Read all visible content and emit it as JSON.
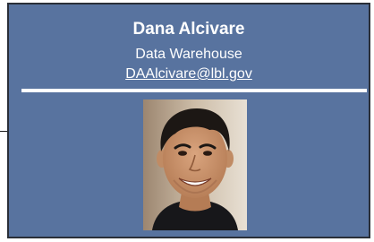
{
  "profile": {
    "name": "Dana Alcivare",
    "department": "Data Warehouse",
    "email": "DAAlcivare@lbl.gov"
  },
  "colors": {
    "card_background": "#58739f",
    "card_border": "#2a2f38",
    "text": "#ffffff",
    "divider": "#ffffff"
  },
  "icons": {
    "photo": "profile-photo"
  }
}
